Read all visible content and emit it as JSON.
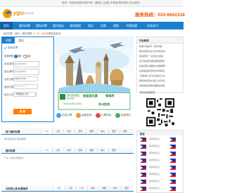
{
  "header": {
    "welcome_text": "您好！欢迎光临阳光旅行网！[登录] | [注册]   手机版  联系我们  设为首页",
    "logo_name": "ygu",
    "logo_tagline": "阳光旅行网",
    "hotline": "服务热线：020-6662228"
  },
  "nav": {
    "items": [
      "首页",
      "国内机票",
      "国际机票",
      "国内酒店",
      "旅游度假",
      "签证",
      "机票",
      "团购",
      "代理加盟",
      "在线支付"
    ]
  },
  "breadcrumb": {
    "prefix": "当前位置：",
    "home": "首页",
    "sep1": " > ",
    "domestic": "国内机票",
    "sep2": " > ",
    "current": "广州 - 北京机票",
    "suffix": "航班查询"
  },
  "search": {
    "tabs": [
      "机票",
      "酒店"
    ],
    "title": "国内机票",
    "trip_label": "航程类型",
    "trip_options": [
      "单程",
      "往返"
    ],
    "from_label": "出发城市",
    "from_placeholder": "如:北京/BJS",
    "to_label": "到达城市",
    "to_placeholder": "如:北京/BJS",
    "depart_label": "出发日期",
    "depart_value": "2025-11-06",
    "return_label": "返回日期",
    "return_value": "2025-11-11",
    "airline_label": "航空公司",
    "airline_value": "-不限航空公司-",
    "search_button": "搜 索"
  },
  "banner": {
    "brand": "胜利香港酒店",
    "brand_sub": "康洲宾馆",
    "promo1": "捷道里机票",
    "promo2": "锦格养",
    "phone": "0512-6751-2010",
    "cta": "苏州旅游"
  },
  "subtabs": [
    "国内机票",
    "国际机票",
    "国内酒店",
    "特价机票",
    "旅游团购"
  ],
  "news": {
    "title": "行业新闻",
    "lines": [
      "机票价格如何 - 特价机票",
      "国内机票价格 出行时间查询",
      "航班查询一 北京到大连航",
      "出行航班查询旅游网选哪家",
      "春运机票 暑期特价机票推荐",
      "机票退改签须知及时间规定",
      "订票指南 出行必读信息汇总",
      "国际航班查询 航空公司专区",
      "民航航班延误补偿相关说明"
    ]
  },
  "qr": {
    "title": "阳光旅游微信"
  },
  "hot_section": {
    "title": "热门城市机票",
    "chips": [
      "广州",
      "上海",
      "北京",
      "深圳",
      "成都",
      "杭州",
      "西安",
      "重庆"
    ],
    "body": "特价机票 热门航线推荐"
  },
  "actions": {
    "items": [
      "在线订票",
      "返程查询",
      "订票热线",
      "旅游预订"
    ]
  },
  "intl_section": {
    "title": "国内机票",
    "chips": [
      "广州",
      "上海",
      "北京",
      "深圳",
      "成都",
      "杭州",
      "西安"
    ],
    "body": "广州 - 北京 航班信息"
  },
  "bottom_section": {
    "title": "北京到上海 机票推荐",
    "chips": [
      "北京",
      "上海",
      "广州",
      "深圳",
      "成都",
      "杭州",
      "西安"
    ]
  },
  "side_box": {
    "title": "签证",
    "rows": [
      "菲律宾签证",
      "菲律宾签证",
      "菲律宾签证",
      "菲律宾签证",
      "菲律宾签证",
      "菲律宾签证",
      "菲律宾签证",
      "菲律宾签证"
    ]
  },
  "colors": {
    "brand_blue": "#1b7fcf",
    "accent_orange": "#ff7e00"
  }
}
